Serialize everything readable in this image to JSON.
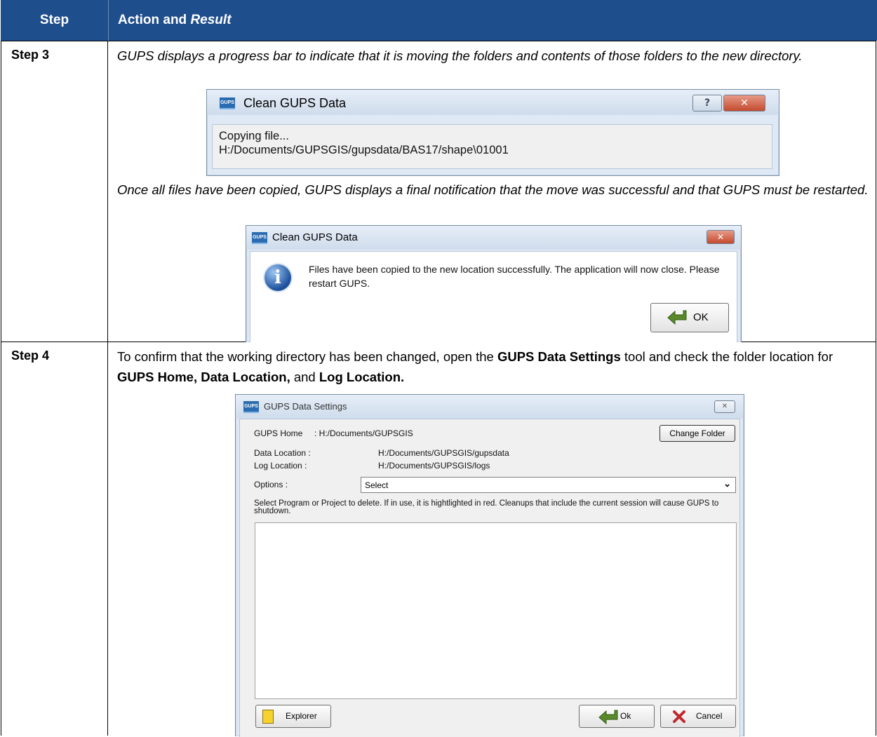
{
  "table": {
    "header_step": "Step",
    "header_action": "Action and ",
    "header_result": "Result"
  },
  "step3": {
    "label": "Step 3",
    "para1": "GUPS displays a progress bar to indicate that it is moving the folders and contents of those folders to the new directory.",
    "para2": "Once all files have been copied, GUPS displays a final notification that the move was successful and that GUPS must be restarted."
  },
  "copy_dialog": {
    "logo": "GUPS",
    "title": "Clean GUPS Data",
    "help": "?",
    "close": "✕",
    "line1": "Copying file...",
    "line2": "H:/Documents/GUPSGIS/gupsdata/BAS17/shape\\01001"
  },
  "done_dialog": {
    "logo": "GUPS",
    "title": "Clean GUPS Data",
    "close": "✕",
    "icon": "i",
    "message": "Files have been copied to the new location successfully. The application will now close. Please restart GUPS.",
    "ok": "OK"
  },
  "step4": {
    "label": "Step 4",
    "text_a": "To confirm that the working directory has been changed, open the ",
    "text_b": "GUPS Data Settings",
    "text_c": " tool and check the folder location for ",
    "text_d": "GUPS Home, Data Location,",
    "text_e": " and ",
    "text_f": "Log Location."
  },
  "settings_dialog": {
    "logo": "GUPS",
    "title": "GUPS Data Settings",
    "close": "✕",
    "home_label": "GUPS Home",
    "home_value": ": H:/Documents/GUPSGIS",
    "change_folder": "Change Folder",
    "data_label": "Data Location :",
    "data_value": "H:/Documents/GUPSGIS/gupsdata",
    "log_label": "Log Location :",
    "log_value": "H:/Documents/GUPSGIS/logs",
    "options_label": "Options :",
    "options_selected": "Select",
    "instructions": "Select Program or Project to delete. If in use, it is hightlighted in red. Cleanups that include the current session will cause GUPS to shutdown.",
    "explorer": "Explorer",
    "ok": "Ok",
    "cancel": "Cancel"
  }
}
